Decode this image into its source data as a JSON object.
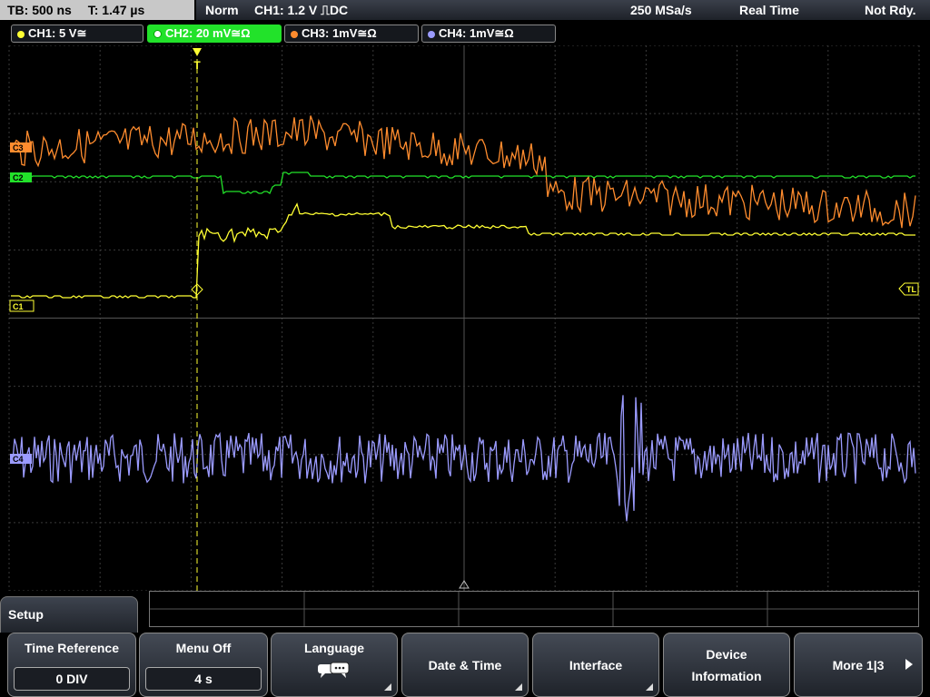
{
  "header": {
    "timebase": "TB: 500 ns",
    "trigger_time": "T: 1.47 µs",
    "mode": "Norm",
    "trigger_info": "CH1: 1.2 V ⎍DC",
    "sample_rate": "250 MSa/s",
    "acquisition": "Real Time",
    "status": "Not Rdy."
  },
  "channels": [
    {
      "label": "CH1: 5 V≅",
      "color": "#ffff33"
    },
    {
      "label": "CH2: 20 mV≅Ω",
      "color": "#22e22a"
    },
    {
      "label": "CH3: 1mV≅Ω",
      "color": "#ff8c2e"
    },
    {
      "label": "CH4: 1mV≅Ω",
      "color": "#9b9bff"
    }
  ],
  "markers": {
    "ch1": "C1",
    "ch2": "C2",
    "ch3": "C3",
    "ch4": "C4",
    "trigger_level": "TL",
    "trigger_pos": "T"
  },
  "menu": {
    "title": "Setup",
    "softkeys": [
      {
        "label": "Time Reference",
        "value": "0 DIV"
      },
      {
        "label": "Menu Off",
        "value": "4 s"
      },
      {
        "label": "Language",
        "icon": "speech-bubble-icon"
      },
      {
        "label": "Date & Time"
      },
      {
        "label": "Interface"
      },
      {
        "label": "Device Information"
      },
      {
        "label": "More 1|3"
      }
    ]
  }
}
